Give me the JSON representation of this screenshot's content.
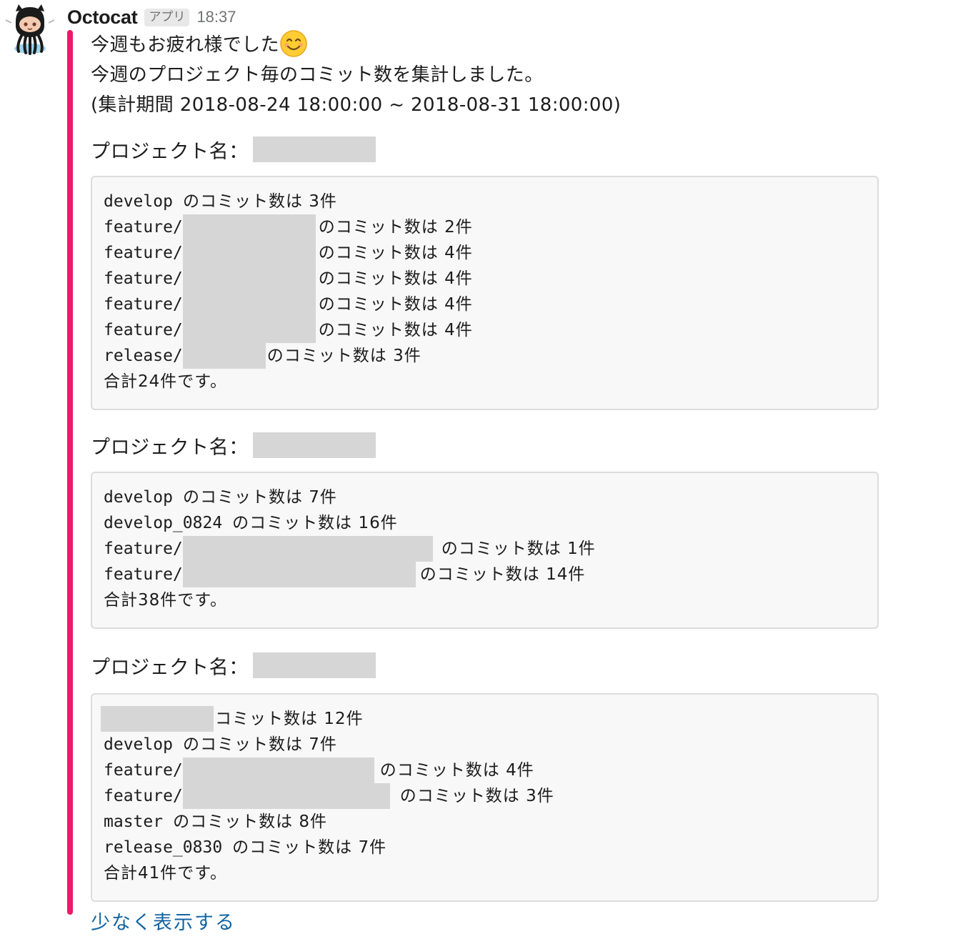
{
  "message": {
    "sender": "Octocat",
    "badge": "アプリ",
    "time": "18:37",
    "accent_color": "#f0176a",
    "avatar_icon": "octocat-avatar-icon",
    "intro": [
      "今週もお疲れ様でした",
      "今週のプロジェクト毎のコミット数を集計しました。",
      "(集計期間 2018-08-24 18:00:00 ~ 2018-08-31 18:00:00)"
    ],
    "emoji": "smiling-face-icon",
    "project_label": "プロジェクト名：",
    "projects": [
      {
        "lines": [
          {
            "prefix": "develop ",
            "suffix": "のコミット数は 3件"
          },
          {
            "prefix": "feature/",
            "suffix": "のコミット数は 2件"
          },
          {
            "prefix": "feature/",
            "suffix": "のコミット数は 4件"
          },
          {
            "prefix": "feature/",
            "suffix": "のコミット数は 4件"
          },
          {
            "prefix": "feature/",
            "suffix": "のコミット数は 4件"
          },
          {
            "prefix": "feature/",
            "suffix": "のコミット数は 4件"
          },
          {
            "prefix": "release/",
            "suffix": "のコミット数は 3件"
          }
        ],
        "total": "合計24件です。"
      },
      {
        "lines": [
          {
            "prefix": "develop ",
            "suffix": "のコミット数は 7件"
          },
          {
            "prefix": "develop_0824 ",
            "suffix": "のコミット数は 16件"
          },
          {
            "prefix": "feature/",
            "suffix": "のコミット数は 1件"
          },
          {
            "prefix": "feature/",
            "suffix": "のコミット数は 14件"
          }
        ],
        "total": "合計38件です。"
      },
      {
        "lines": [
          {
            "prefix": "",
            "suffix": "コミット数は 12件"
          },
          {
            "prefix": "develop ",
            "suffix": "のコミット数は 7件"
          },
          {
            "prefix": "feature/",
            "suffix": "のコミット数は 4件"
          },
          {
            "prefix": "feature/",
            "suffix": "のコミット数は 3件"
          },
          {
            "prefix": "master ",
            "suffix": "のコミット数は 8件"
          },
          {
            "prefix": "release_0830 ",
            "suffix": "のコミット数は 7件"
          }
        ],
        "total": "合計41件です。"
      }
    ],
    "show_less": "少なく表示する"
  }
}
